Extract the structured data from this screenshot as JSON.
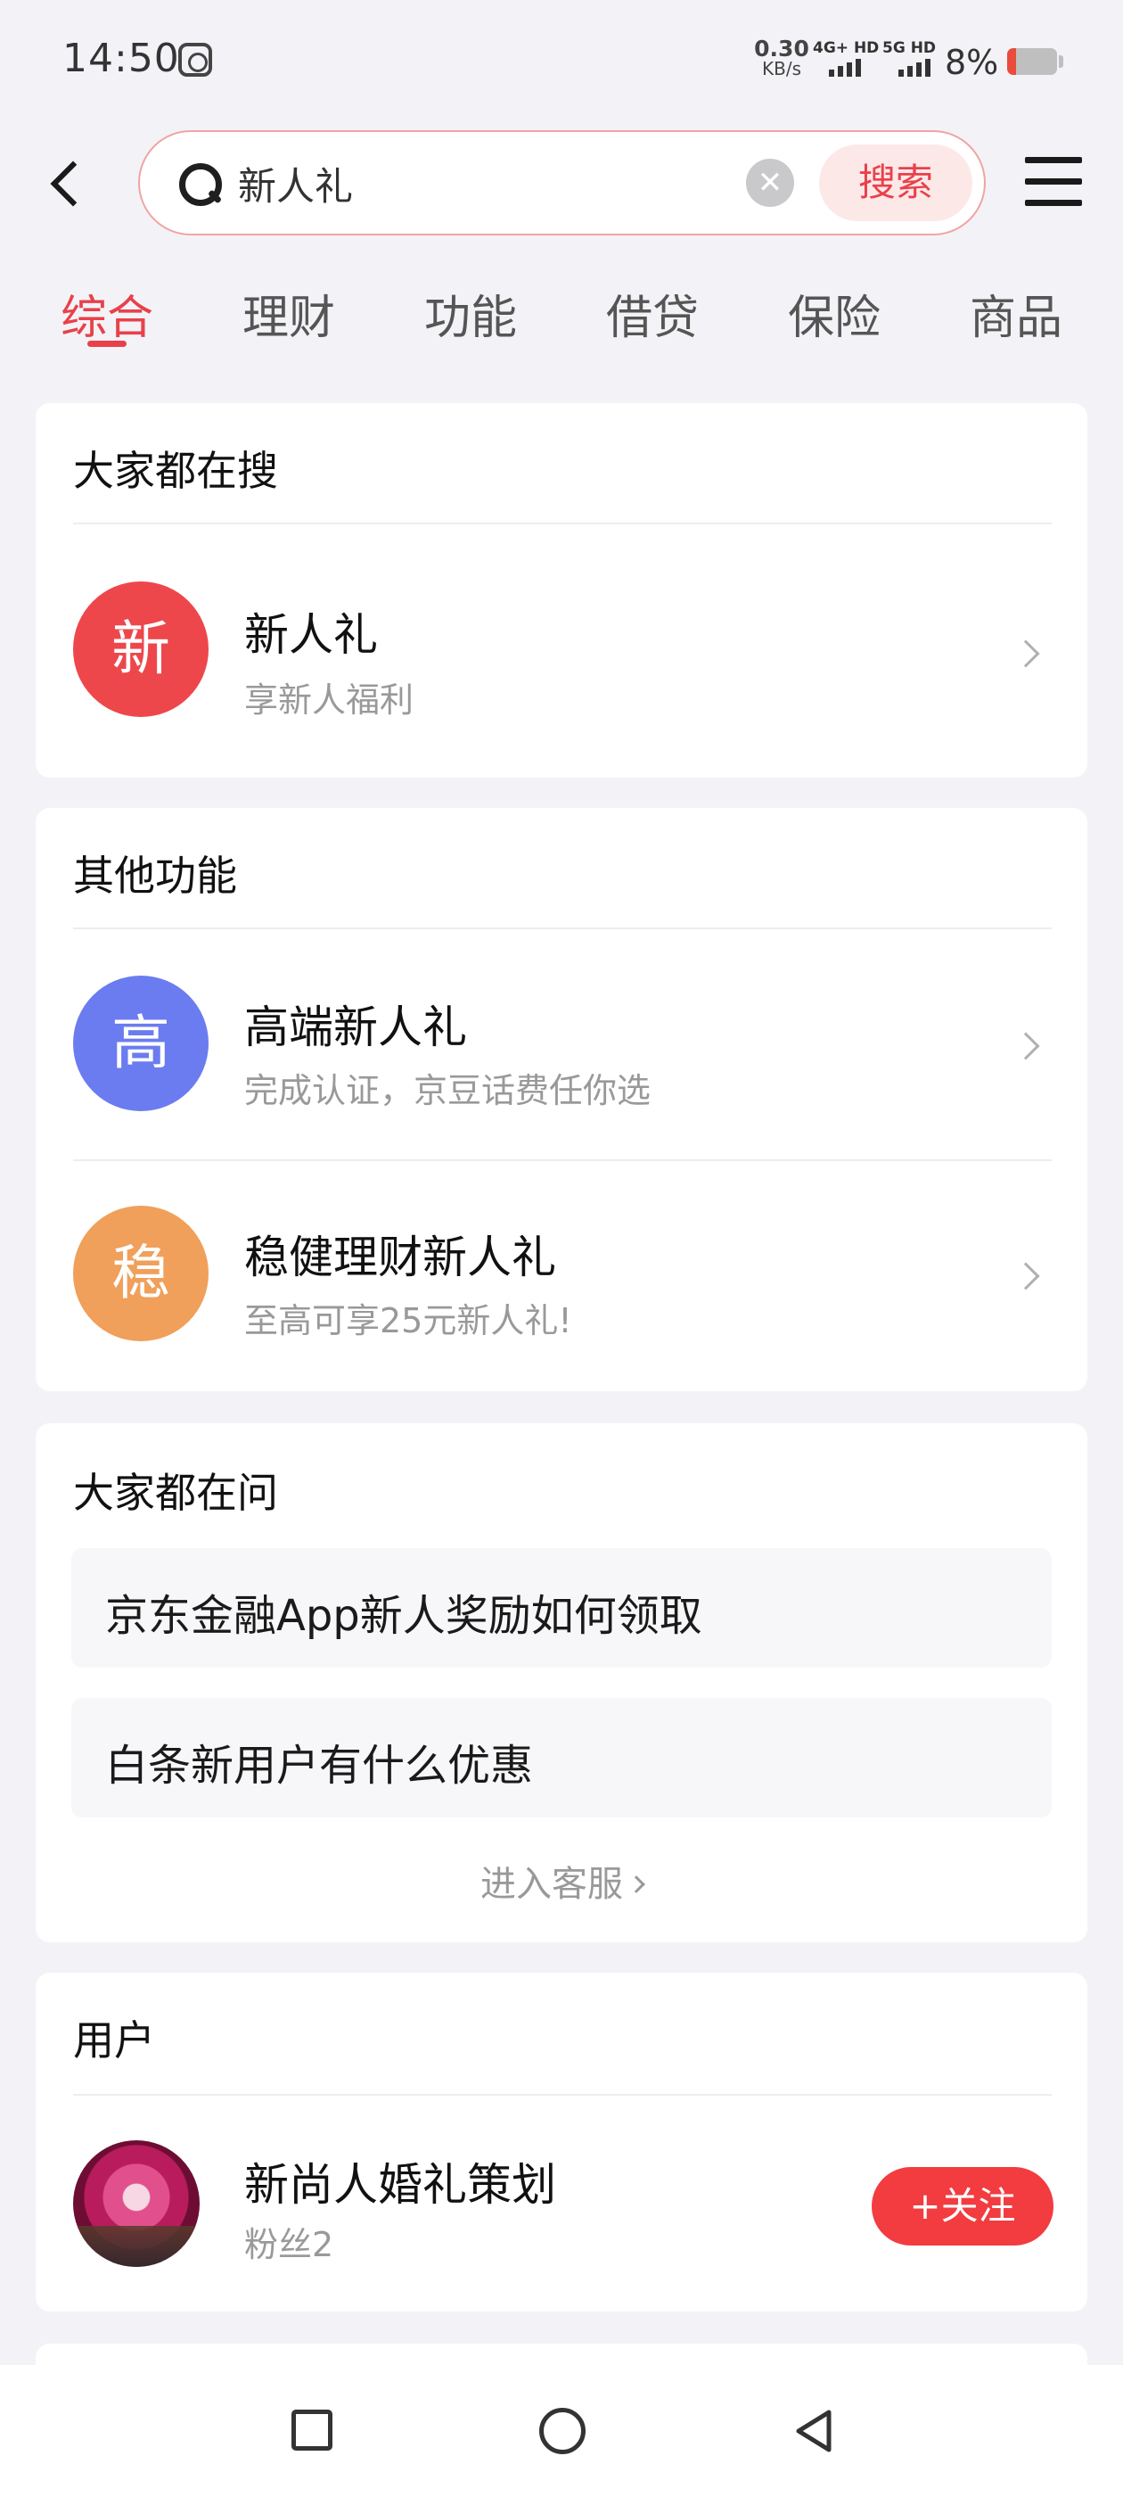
{
  "status_bar": {
    "time": "14:50",
    "net_speed_value": "0.30",
    "net_speed_unit": "KB/s",
    "sim1_label": "4G+ HD",
    "sim2_label": "5G HD",
    "battery_percent": "8%",
    "battery_level": 0.08,
    "battery_color": "#e94b3c"
  },
  "search": {
    "query": "新人礼",
    "button_label": "搜索",
    "back_icon": "back-arrow-icon",
    "menu_icon": "hamburger-menu-icon"
  },
  "tabs": [
    "综合",
    "理财",
    "功能",
    "借贷",
    "保险",
    "商品"
  ],
  "active_tab": "综合",
  "popular": {
    "title": "大家都在搜",
    "item": {
      "badge": "新",
      "badge_color": "#ed474c",
      "title": "新人礼",
      "subtitle": "享新人福利"
    }
  },
  "other_functions": {
    "title": "其他功能",
    "items": [
      {
        "badge": "高",
        "badge_color": "#6b7cf0",
        "title": "高端新人礼",
        "subtitle": "完成认证，京豆话费任你选"
      },
      {
        "badge": "稳",
        "badge_color": "#f0a05a",
        "title": "稳健理财新人礼",
        "subtitle": "至高可享25元新人礼!"
      }
    ]
  },
  "questions": {
    "title": "大家都在问",
    "items": [
      "京东金融App新人奖励如何领取",
      "白条新用户有什么优惠"
    ],
    "service_link": "进入客服"
  },
  "users": {
    "title": "用户",
    "item": {
      "name": "新尚人婚礼策划",
      "fans": "粉丝2",
      "follow_label": "+关注"
    }
  },
  "colors": {
    "accent": "#e8414a",
    "background": "#f3f3f7",
    "follow_button": "#f23c40"
  }
}
